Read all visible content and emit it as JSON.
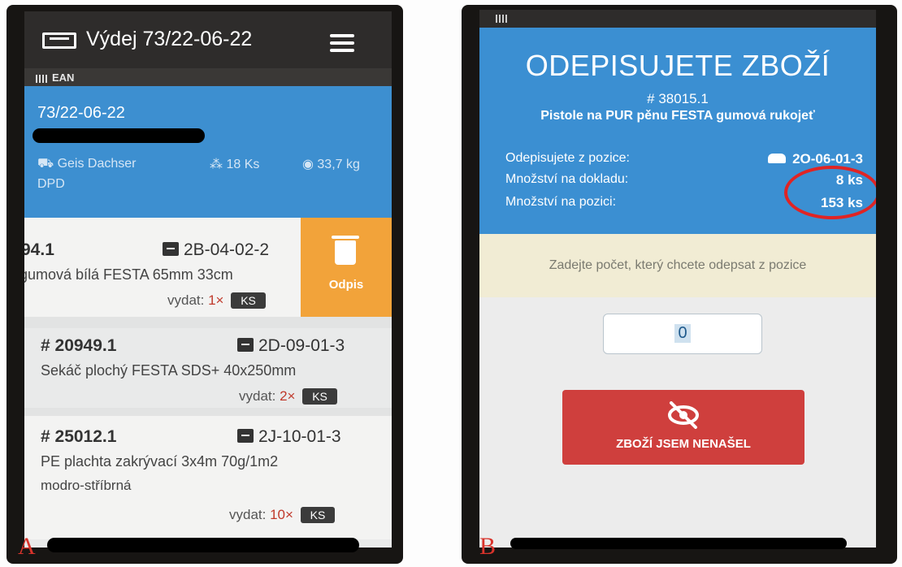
{
  "panelA": {
    "label": "A",
    "app_title": "Výdej 73/22-06-22",
    "ean_label": "EAN",
    "doc_number": "73/22-06-22",
    "carrier": "Geis Dachser",
    "carrier2": "DPD",
    "total_count": "18 Ks",
    "total_weight": "33,7 kg",
    "items": [
      {
        "code": "94.1",
        "position": "2B-04-02-2",
        "description": "gumová bílá FESTA 65mm 33cm",
        "vydat_label": "vydat:",
        "qty": "1×",
        "unit": "KS"
      },
      {
        "code": "# 20949.1",
        "position": "2D-09-01-3",
        "description": "Sekáč plochý FESTA SDS+ 40x250mm",
        "vydat_label": "vydat:",
        "qty": "2×",
        "unit": "KS"
      },
      {
        "code": "# 25012.1",
        "position": "2J-10-01-3",
        "description": "PE plachta zakrývací 3x4m 70g/1m2",
        "description2": "modro-stříbrná",
        "vydat_label": "vydat:",
        "qty": "10×",
        "unit": "KS"
      }
    ],
    "swipe_action": "Odpis"
  },
  "panelB": {
    "label": "B",
    "title": "ODEPISUJETE ZBOŽÍ",
    "item_code": "# 38015.1",
    "item_name": "Pistole na PUR pěnu FESTA gumová rukojeť",
    "rows": [
      {
        "label": "Odepisujete z pozice:",
        "value": "2O-06-01-3"
      },
      {
        "label": "Množství na dokladu:",
        "value": "8 ks"
      },
      {
        "label": "Množství na pozici:",
        "value": "153 ks"
      }
    ],
    "hint": "Zadejte počet, který chcete odepsat z pozice",
    "input_value": "0",
    "button_label": "ZBOŽÍ JSEM NENAŠEL"
  }
}
